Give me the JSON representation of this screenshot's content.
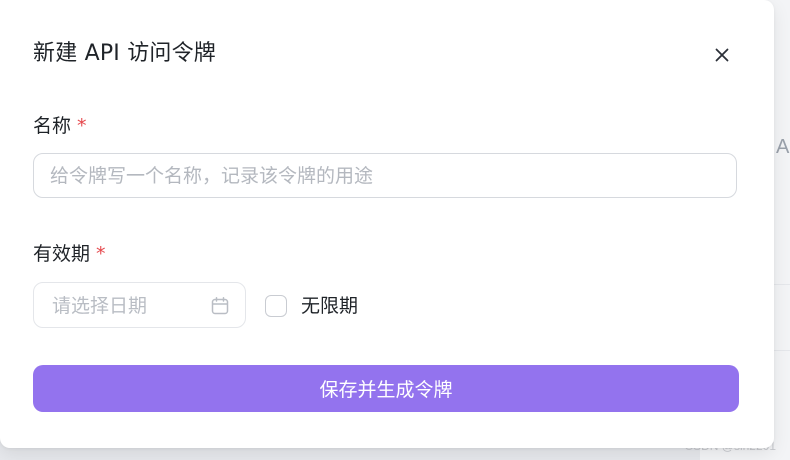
{
  "dialog": {
    "title": "新建 API 访问令牌",
    "close_icon": "close-icon"
  },
  "form": {
    "name": {
      "label": "名称",
      "required_mark": "*",
      "value": "",
      "placeholder": "给令牌写一个名称，记录该令牌的用途"
    },
    "expiry": {
      "label": "有效期",
      "required_mark": "*",
      "date_placeholder": "请选择日期",
      "date_icon": "calendar-icon",
      "no_limit_label": "无限期",
      "no_limit_checked": false
    },
    "submit_label": "保存并生成令牌"
  },
  "background": {
    "partial_letter": "A",
    "watermark": "CSDN @sin2201"
  },
  "colors": {
    "accent": "#9373ee",
    "required": "#e5484d",
    "text": "#1f2328",
    "placeholder": "#b4b8bf"
  }
}
